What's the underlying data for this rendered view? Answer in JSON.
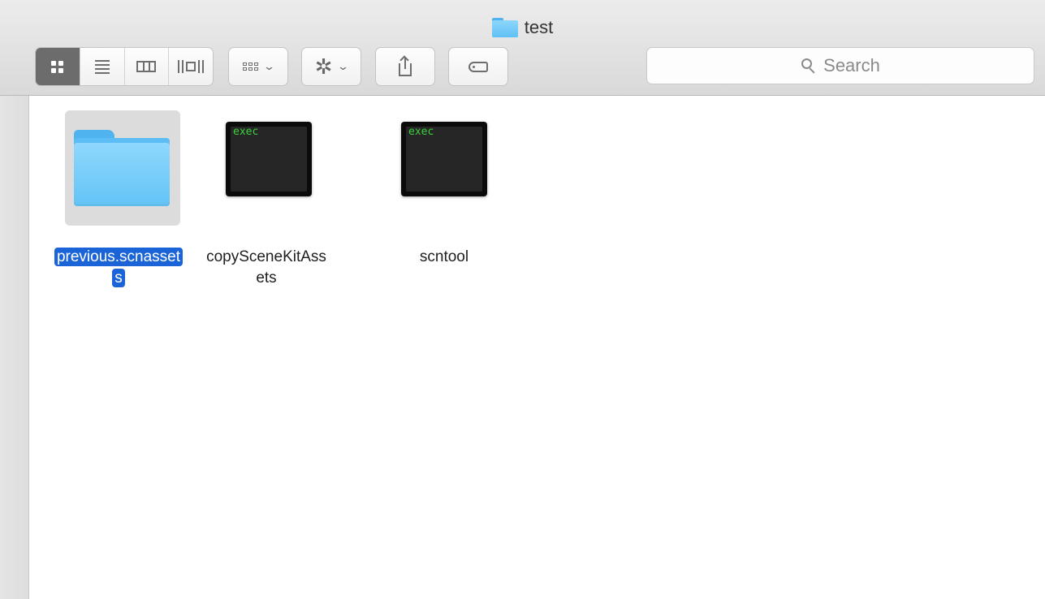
{
  "window": {
    "title": "test"
  },
  "toolbar": {
    "view_modes": [
      {
        "name": "icon-view",
        "active": true
      },
      {
        "name": "list-view",
        "active": false
      },
      {
        "name": "column-view",
        "active": false
      },
      {
        "name": "cover-flow-view",
        "active": false
      }
    ],
    "search_placeholder": "Search",
    "icons": {
      "arrange": "arrange-icon",
      "action": "gear-icon",
      "share": "share-icon",
      "tags": "tag-icon",
      "dropdown": "chevron-down-icon"
    }
  },
  "files": [
    {
      "name": "previous.scnassets",
      "line1": "previous.scnasset",
      "line2": "s",
      "kind": "folder",
      "selected": true
    },
    {
      "name": "copySceneKitAssets",
      "line1": "copySceneKitAss",
      "line2": "ets",
      "kind": "exec",
      "icon_text": "exec",
      "selected": false
    },
    {
      "name": "scntool",
      "line1": "scntool",
      "line2": "",
      "kind": "exec",
      "icon_text": "exec",
      "selected": false
    }
  ],
  "colors": {
    "selection": "#1a64d8",
    "folder": "#63c4f6",
    "exec_text": "#3cd13c"
  }
}
